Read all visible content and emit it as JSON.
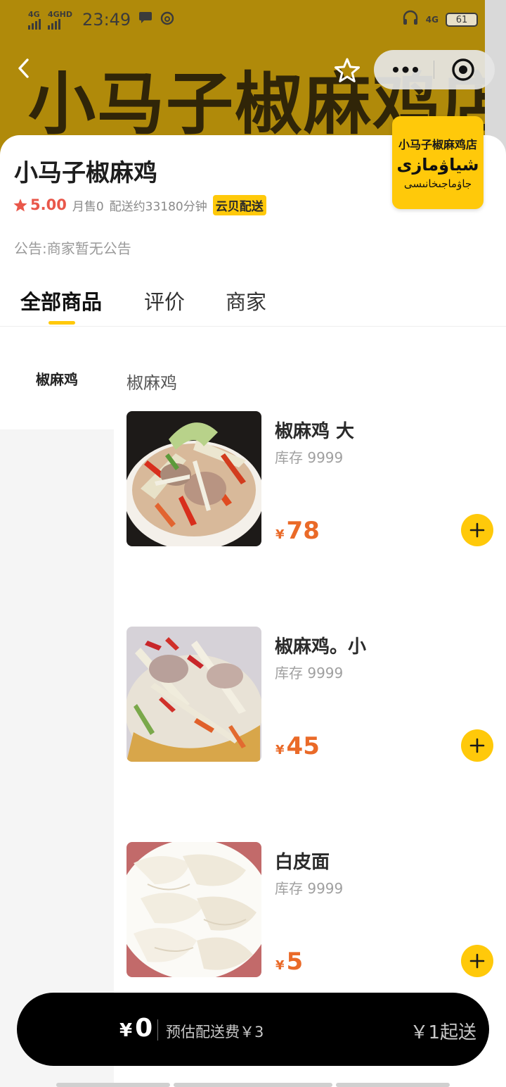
{
  "status_bar": {
    "network1": "4G",
    "network2": "4GHD",
    "time": "23:49",
    "battery": "61",
    "right_net": "4G"
  },
  "banner": {
    "background_text": "小马子椒麻鸡店"
  },
  "shop": {
    "name": "小马子椒麻鸡",
    "logo_cn": "小马子椒麻鸡店",
    "logo_ug_line1": "شياۋمازى",
    "logo_ug_line2": "جاۋماجىخانىسى",
    "rating": "5.00",
    "monthly_sales": "月售0",
    "delivery_time": "配送约33180分钟",
    "delivery_badge": "云贝配送",
    "notice": "公告:商家暂无公告"
  },
  "tabs": [
    {
      "label": "全部商品",
      "active": true
    },
    {
      "label": "评价",
      "active": false
    },
    {
      "label": "商家",
      "active": false
    }
  ],
  "sidebar": {
    "items": [
      {
        "label": "椒麻鸡",
        "active": true
      }
    ]
  },
  "section_title": "椒麻鸡",
  "products": [
    {
      "name": "椒麻鸡 大",
      "stock": "库存 9999",
      "currency": "¥",
      "price": "78"
    },
    {
      "name": "椒麻鸡。小",
      "stock": "库存 9999",
      "currency": "¥",
      "price": "45"
    },
    {
      "name": "白皮面",
      "stock": "库存 9999",
      "currency": "¥",
      "price": "5"
    }
  ],
  "cart": {
    "currency": "¥",
    "total": "0",
    "delivery_fee": "预估配送费￥3",
    "min_order": "￥1起送"
  },
  "colors": {
    "accent": "#ffc90a",
    "price": "#ea6a28",
    "rating": "#e9574a",
    "bottom_bar": "#000000"
  }
}
